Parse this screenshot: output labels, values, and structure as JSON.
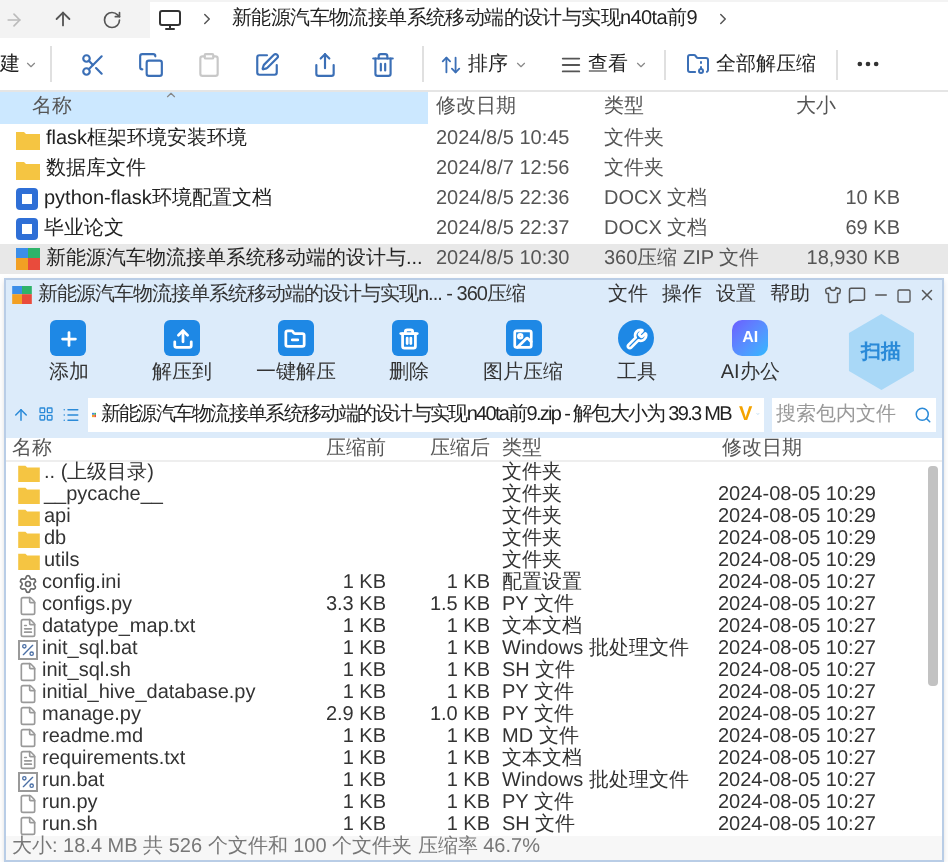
{
  "explorer": {
    "path": "新能源汽车物流接单系统移动端的设计与实现n40ta前9",
    "toolbar": {
      "new_label": "建",
      "icons": [
        {
          "kind": "cut",
          "disabled": false
        },
        {
          "kind": "copy",
          "disabled": false
        },
        {
          "kind": "paste",
          "disabled": true
        },
        {
          "kind": "rename",
          "disabled": false
        },
        {
          "kind": "share",
          "disabled": false
        },
        {
          "kind": "delete",
          "disabled": false
        }
      ],
      "sort": "排序",
      "view": "查看",
      "extract_all": "全部解压缩"
    },
    "columns": [
      "名称",
      "修改日期",
      "类型",
      "大小"
    ],
    "rows": [
      {
        "kind": "folder",
        "name": "flask框架环境安装环境",
        "date": "2024/8/5 10:45",
        "type": "文件夹",
        "size": "",
        "selected": false
      },
      {
        "kind": "folder",
        "name": "数据库文件",
        "date": "2024/8/7 12:56",
        "type": "文件夹",
        "size": "",
        "selected": false
      },
      {
        "kind": "docx",
        "name": "python-flask环境配置文档",
        "date": "2024/8/5 22:36",
        "type": "DOCX 文档",
        "size": "10 KB",
        "selected": false
      },
      {
        "kind": "docx",
        "name": "毕业论文",
        "date": "2024/8/5 22:37",
        "type": "DOCX 文档",
        "size": "69 KB",
        "selected": false
      },
      {
        "kind": "zip",
        "name": "新能源汽车物流接单系统移动端的设计与...",
        "date": "2024/8/5 10:30",
        "type": "360压缩 ZIP 文件",
        "size": "18,930 KB",
        "selected": true
      }
    ]
  },
  "archive_window": {
    "title": "新能源汽车物流接单系统移动端的设计与实现n... - 360压缩",
    "menu": [
      "文件",
      "操作",
      "设置",
      "帮助"
    ],
    "tools": [
      {
        "kind": "add",
        "label": "添加"
      },
      {
        "kind": "extract_to",
        "label": "解压到"
      },
      {
        "kind": "quick_extract",
        "label": "一键解压"
      },
      {
        "kind": "delete",
        "label": "删除"
      },
      {
        "kind": "image",
        "label": "图片压缩"
      },
      {
        "kind": "tools",
        "label": "工具"
      },
      {
        "kind": "ai",
        "label": "AI办公",
        "badge": "AI"
      }
    ],
    "scan": "扫描",
    "address": {
      "path": "新能源汽车物流接单系统移动端的设计与实现n40ta前9.zip - 解包大小为 39.3 MB",
      "vip_badge": "V",
      "search_placeholder": "搜索包内文件"
    },
    "columns": [
      "名称",
      "压缩前",
      "压缩后",
      "类型",
      "修改日期"
    ],
    "rows": [
      {
        "kind": "folder",
        "name": ".. (上级目录)",
        "before": "",
        "after": "",
        "type": "文件夹",
        "date": ""
      },
      {
        "kind": "folder",
        "name": "__pycache__",
        "before": "",
        "after": "",
        "type": "文件夹",
        "date": "2024-08-05 10:29"
      },
      {
        "kind": "folder",
        "name": "api",
        "before": "",
        "after": "",
        "type": "文件夹",
        "date": "2024-08-05 10:29"
      },
      {
        "kind": "folder",
        "name": "db",
        "before": "",
        "after": "",
        "type": "文件夹",
        "date": "2024-08-05 10:29"
      },
      {
        "kind": "folder",
        "name": "utils",
        "before": "",
        "after": "",
        "type": "文件夹",
        "date": "2024-08-05 10:29"
      },
      {
        "kind": "settings",
        "name": "config.ini",
        "before": "1 KB",
        "after": "1 KB",
        "type": "配置设置",
        "date": "2024-08-05 10:27"
      },
      {
        "kind": "file",
        "name": "configs.py",
        "before": "3.3 KB",
        "after": "1.5 KB",
        "type": "PY 文件",
        "date": "2024-08-05 10:27"
      },
      {
        "kind": "text",
        "name": "datatype_map.txt",
        "before": "1 KB",
        "after": "1 KB",
        "type": "文本文档",
        "date": "2024-08-05 10:27"
      },
      {
        "kind": "script",
        "name": "init_sql.bat",
        "before": "1 KB",
        "after": "1 KB",
        "type": "Windows 批处理文件",
        "date": "2024-08-05 10:27"
      },
      {
        "kind": "file",
        "name": "init_sql.sh",
        "before": "1 KB",
        "after": "1 KB",
        "type": "SH 文件",
        "date": "2024-08-05 10:27"
      },
      {
        "kind": "file",
        "name": "initial_hive_database.py",
        "before": "1 KB",
        "after": "1 KB",
        "type": "PY 文件",
        "date": "2024-08-05 10:27"
      },
      {
        "kind": "file",
        "name": "manage.py",
        "before": "2.9 KB",
        "after": "1.0 KB",
        "type": "PY 文件",
        "date": "2024-08-05 10:27"
      },
      {
        "kind": "file",
        "name": "readme.md",
        "before": "1 KB",
        "after": "1 KB",
        "type": "MD 文件",
        "date": "2024-08-05 10:27"
      },
      {
        "kind": "text",
        "name": "requirements.txt",
        "before": "1 KB",
        "after": "1 KB",
        "type": "文本文档",
        "date": "2024-08-05 10:27"
      },
      {
        "kind": "script",
        "name": "run.bat",
        "before": "1 KB",
        "after": "1 KB",
        "type": "Windows 批处理文件",
        "date": "2024-08-05 10:27"
      },
      {
        "kind": "file",
        "name": "run.py",
        "before": "1 KB",
        "after": "1 KB",
        "type": "PY 文件",
        "date": "2024-08-05 10:27"
      },
      {
        "kind": "file",
        "name": "run.sh",
        "before": "1 KB",
        "after": "1 KB",
        "type": "SH 文件",
        "date": "2024-08-05 10:27"
      }
    ],
    "status": "大小: 18.4 MB 共 526 个文件和 100 个文件夹 压缩率 46.7%"
  }
}
